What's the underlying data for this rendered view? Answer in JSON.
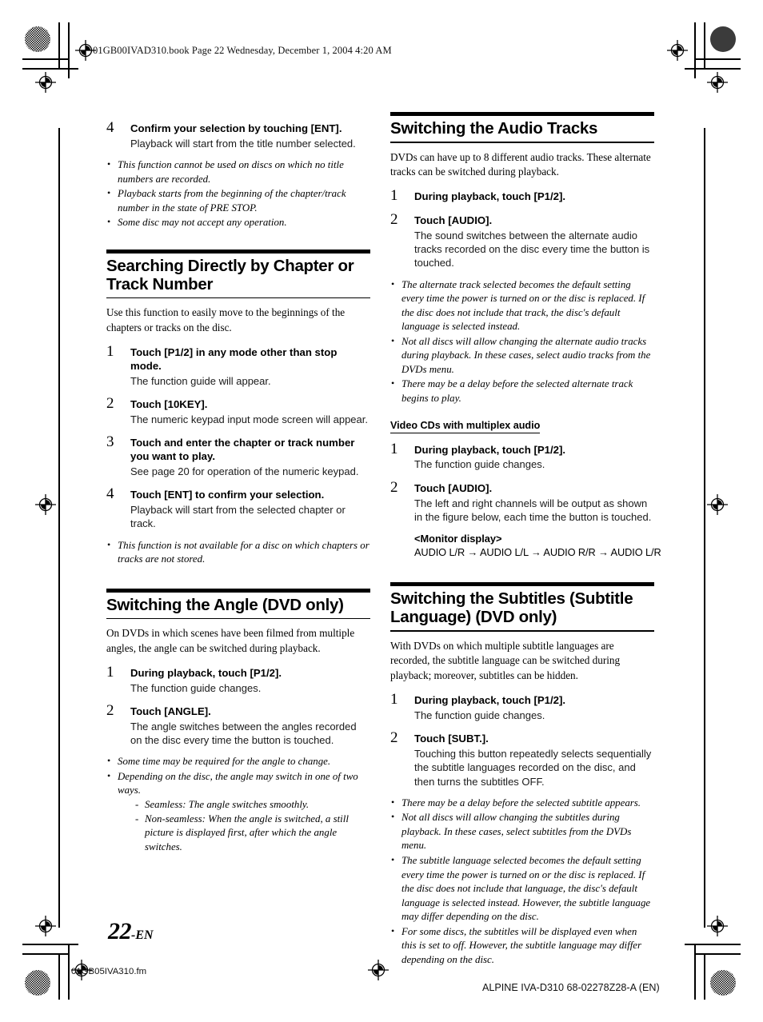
{
  "header": {
    "slug": "01GB00IVAD310.book  Page 22  Wednesday, December 1, 2004  4:20 AM"
  },
  "footer": {
    "page_number": "22",
    "page_suffix": "-EN",
    "left_slug": "01GB05IVA310.fm",
    "right_slug": "ALPINE IVA-D310 68-02278Z28-A (EN)"
  },
  "left_column": {
    "step4_top": {
      "num": "4",
      "title": "Confirm your selection by touching [ENT].",
      "desc": "Playback will start from the title number selected."
    },
    "notes_top": [
      "This function cannot be used on discs on which no title numbers are recorded.",
      "Playback starts from the beginning of the chapter/track number in the state of PRE STOP.",
      "Some disc may not accept any operation."
    ],
    "section_search": {
      "heading": "Searching Directly by Chapter or Track Number",
      "intro": "Use this function to easily move to the beginnings of the chapters or tracks on the disc.",
      "steps": [
        {
          "num": "1",
          "title": "Touch [P1/2] in any mode other than stop mode.",
          "desc": "The function guide will appear."
        },
        {
          "num": "2",
          "title": "Touch [10KEY].",
          "desc": "The numeric keypad input mode screen will appear."
        },
        {
          "num": "3",
          "title": "Touch and enter the chapter or track number you want to play.",
          "desc": "See page 20 for operation of the numeric keypad."
        },
        {
          "num": "4",
          "title": "Touch [ENT] to confirm your selection.",
          "desc": "Playback will start from the selected chapter or track."
        }
      ],
      "notes": [
        "This function is not available for a disc on which chapters or tracks are not stored."
      ]
    },
    "section_angle": {
      "heading": "Switching the Angle (DVD only)",
      "intro": "On DVDs in which scenes have been filmed from multiple angles, the angle can be switched during playback.",
      "steps": [
        {
          "num": "1",
          "title": "During playback, touch [P1/2].",
          "desc": "The function guide changes."
        },
        {
          "num": "2",
          "title": "Touch [ANGLE].",
          "desc": "The angle switches between the angles recorded on the disc every time the button is touched."
        }
      ],
      "notes": [
        "Some time may be required for the angle to change.",
        "Depending on the disc, the angle may switch in one of two ways."
      ],
      "subnotes": [
        "Seamless:  The angle switches smoothly.",
        "Non-seamless:  When the angle is switched, a still picture is displayed first, after which the angle switches."
      ]
    }
  },
  "right_column": {
    "section_audio": {
      "heading": "Switching the Audio Tracks",
      "intro": "DVDs can have up to 8 different audio tracks. These alternate tracks can be switched during playback.",
      "steps": [
        {
          "num": "1",
          "title": "During playback, touch [P1/2].",
          "desc": ""
        },
        {
          "num": "2",
          "title": "Touch [AUDIO].",
          "desc": "The sound switches between the alternate audio tracks recorded on the disc every time the button is touched."
        }
      ],
      "notes": [
        "The alternate track selected becomes the default setting every time the power is turned on or the disc is replaced. If the disc does not include that track, the disc's default language is selected instead.",
        "Not all discs will allow changing the alternate audio tracks during playback. In these cases, select audio tracks from the DVDs menu.",
        "There may be a delay before the selected alternate track begins to play."
      ],
      "subsection": {
        "heading": "Video CDs with multiplex audio",
        "steps": [
          {
            "num": "1",
            "title": "During playback, touch [P1/2].",
            "desc": "The function guide changes."
          },
          {
            "num": "2",
            "title": "Touch [AUDIO].",
            "desc": "The left and right channels will be output as shown in the figure below, each time the button is touched."
          }
        ],
        "monitor_label": "<Monitor display>",
        "monitor_flow": "AUDIO L/R → AUDIO L/L → AUDIO R/R → AUDIO L/R"
      }
    },
    "section_subtitles": {
      "heading": "Switching the Subtitles (Subtitle Language) (DVD only)",
      "intro": "With DVDs on which multiple subtitle languages are recorded, the subtitle language can be switched during playback; moreover, subtitles can be hidden.",
      "steps": [
        {
          "num": "1",
          "title": "During playback, touch [P1/2].",
          "desc": "The function guide changes."
        },
        {
          "num": "2",
          "title": "Touch [SUBT.].",
          "desc": "Touching this button repeatedly selects sequentially the subtitle languages recorded on the disc, and then turns the subtitles OFF."
        }
      ],
      "notes": [
        "There may be a delay before the selected subtitle appears.",
        "Not all discs will allow changing the subtitles during playback. In these cases, select subtitles from the DVDs menu.",
        "The subtitle language selected becomes the default setting every time the power is turned on or the disc is replaced. If the disc does not include that language, the disc's default language is selected instead. However, the subtitle language may differ depending on the disc.",
        "For some discs, the subtitles will be displayed even when this is set to off. However, the subtitle language may differ depending on the disc."
      ]
    }
  }
}
